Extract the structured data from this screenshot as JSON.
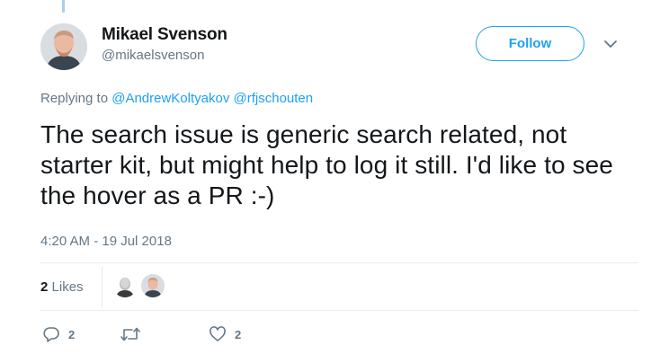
{
  "author": {
    "name": "Mikael Svenson",
    "handle": "@mikaelsvenson"
  },
  "follow_label": "Follow",
  "replying": {
    "prefix": "Replying to",
    "mentions": [
      "@AndrewKoltyakov",
      "@rfjschouten"
    ]
  },
  "tweet": {
    "text": "The search issue is generic search related, not starter kit, but might help to log it still. I'd like to see the hover as a PR :-)",
    "timestamp": "4:20 AM - 19 Jul 2018"
  },
  "stats": {
    "likes_count": "2",
    "likes_label": "Likes"
  },
  "actions": {
    "reply_count": "2",
    "retweet_count": "",
    "like_count": "2"
  },
  "icons": [
    "chevron-down-icon",
    "reply-icon",
    "retweet-icon",
    "heart-icon"
  ],
  "colors": {
    "accent": "#1da1f2",
    "muted": "#657786",
    "text": "#14171a",
    "divider": "#e6ecf0"
  }
}
